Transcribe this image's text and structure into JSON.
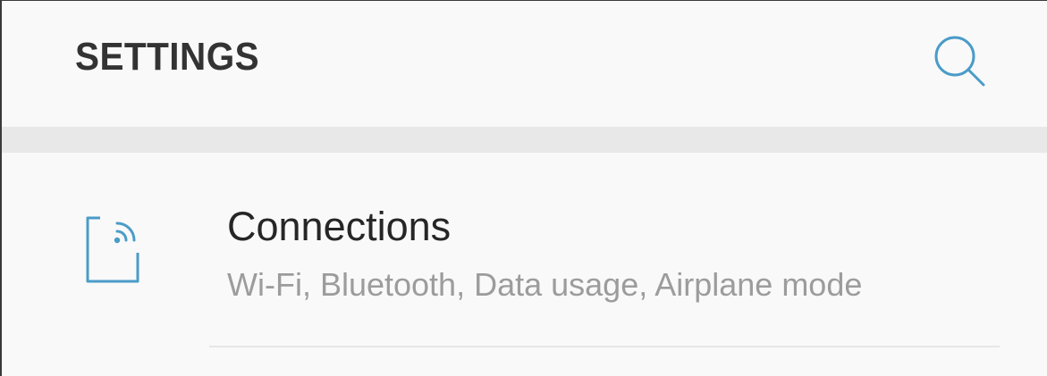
{
  "header": {
    "title": "SETTINGS",
    "search_icon": "search-icon"
  },
  "items": [
    {
      "icon": "connections-icon",
      "title": "Connections",
      "subtitle": "Wi-Fi, Bluetooth, Data usage, Airplane mode"
    }
  ],
  "colors": {
    "accent": "#4a9cc8",
    "title_text": "#333333",
    "subtitle_text": "#9c9c9c",
    "divider_band": "#e8e8e8"
  }
}
